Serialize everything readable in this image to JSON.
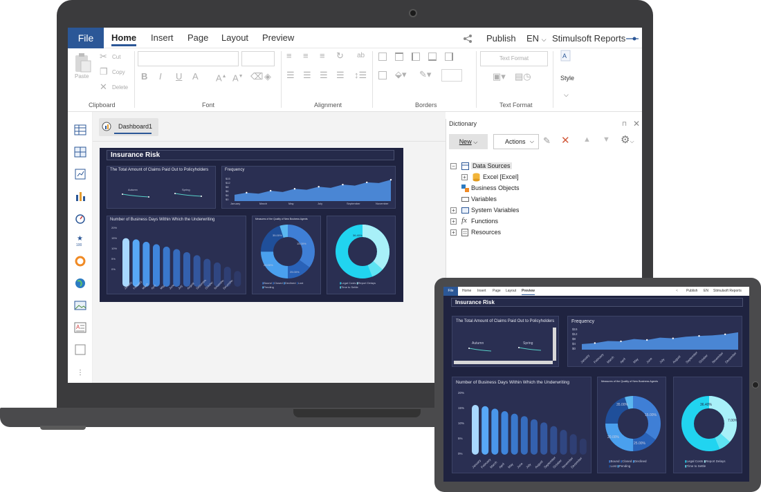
{
  "menu": {
    "file": "File",
    "tabs": [
      "Home",
      "Insert",
      "Page",
      "Layout",
      "Preview"
    ],
    "active_tab": "Home",
    "publish": "Publish",
    "language": "EN",
    "product": "Stimulsoft Reports"
  },
  "ribbon": {
    "clipboard": {
      "paste": "Paste",
      "cut": "Cut",
      "copy": "Copy",
      "delete": "Delete",
      "label": "Clipboard"
    },
    "font": {
      "label": "Font",
      "bold": "B",
      "italic": "I",
      "underline": "U",
      "color": "A"
    },
    "alignment": {
      "label": "Alignment"
    },
    "borders": {
      "label": "Borders"
    },
    "text_format": {
      "placeholder": "Text Format",
      "label": "Text Format"
    },
    "style": {
      "label": "Style"
    }
  },
  "workspace": {
    "tab": "Dashboard1"
  },
  "dashboard": {
    "title": "Insurance Risk",
    "claims_panel": {
      "title": "The Total Amount of Claims Paid Out to Policyholders",
      "labels": [
        "Autumn",
        "Spring"
      ]
    },
    "frequency_panel": {
      "title": "Frequency",
      "y_ticks": [
        "$15",
        "$12",
        "$8",
        "$6",
        "$4",
        "$0"
      ],
      "x_labels": [
        "January",
        "March",
        "May",
        "July",
        "September",
        "November"
      ]
    },
    "days_panel": {
      "title": "Number of Business Days Within Which the Underwriting",
      "y_ticks": [
        "20%",
        "15%",
        "10%",
        "5%",
        "0%"
      ]
    },
    "agents_panel": {
      "title": "Measures of the Quality of New Business Agents",
      "labels": [
        "35.00%",
        "15.00%",
        "20.00%",
        "25.00%"
      ],
      "legend": [
        "Bound",
        "Closed",
        "Declined",
        "Lost",
        "Pending"
      ]
    },
    "claims_ring_panel": {
      "labels": [
        "36.40%"
      ],
      "legend": [
        "Legal Costs",
        "Report Delays",
        "Time to Settle"
      ]
    }
  },
  "dictionary": {
    "title": "Dictionary",
    "new_button": "New",
    "actions_button": "Actions",
    "tree": [
      {
        "label": "Data Sources",
        "selected": true
      },
      {
        "label": "Excel [Excel]"
      },
      {
        "label": "Business Objects"
      },
      {
        "label": "Variables"
      },
      {
        "label": "System Variables"
      },
      {
        "label": "Functions"
      },
      {
        "label": "Resources"
      }
    ]
  },
  "tablet": {
    "menu": {
      "file": "File",
      "tabs": [
        "Home",
        "Insert",
        "Page",
        "Layout",
        "Preview"
      ],
      "active_tab": "Preview",
      "publish": "Publish",
      "language": "EN",
      "product": "Stimulsoft Reports"
    },
    "dashboard": {
      "title": "Insurance Risk",
      "claims_title": "The Total Amount of Claims Paid Out to Policyholders",
      "claims_labels": [
        "Autumn",
        "Spring"
      ],
      "frequency_title": "Frequency",
      "y_ticks": [
        "$15",
        "$12",
        "$8",
        "$4",
        "$0"
      ],
      "months": [
        "January",
        "February",
        "March",
        "April",
        "May",
        "June",
        "July",
        "August",
        "September",
        "October",
        "November",
        "December"
      ],
      "days_title": "Number of Business Days Within Which the Underwriting",
      "days_y_ticks": [
        "20%",
        "15%",
        "10%",
        "5%",
        "0%"
      ],
      "agents_title": "Measures of the Quality of New Business Agents",
      "agents_labels": [
        "35.00%",
        "15.00%",
        "20.00%",
        "25.00%"
      ],
      "agents_legend": [
        "Bound",
        "Closed",
        "Declined",
        "Lost",
        "Pending"
      ],
      "ring_labels": [
        "36.40%",
        "7.00%"
      ],
      "ring_legend": [
        "Legal Costs",
        "Report Delays",
        "Time to Settle"
      ]
    }
  },
  "colors": {
    "accent": "#2b5797",
    "dashboard_bg": "#1f2340",
    "panel_bg": "#2a2f52",
    "area_fill": "#4a86d4",
    "cyan": "#21d4f0"
  }
}
